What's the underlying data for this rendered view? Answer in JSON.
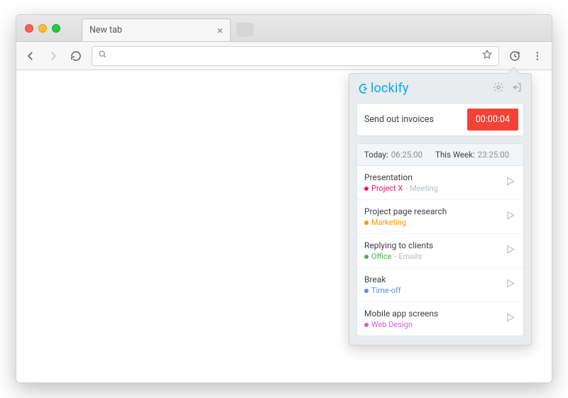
{
  "tab": {
    "title": "New tab"
  },
  "address": {
    "placeholder": ""
  },
  "popup": {
    "brand": "lockify",
    "current": {
      "label": "Send out invoices",
      "timer": "00:00:04"
    },
    "summary": {
      "today_label": "Today:",
      "today_value": "06:25:00",
      "week_label": "This Week:",
      "week_value": "23:25:00"
    },
    "entries": [
      {
        "title": "Presentation",
        "project": "Project X",
        "task": "Meeting",
        "color": "#e91e63"
      },
      {
        "title": "Project page research",
        "project": "Marketing",
        "task": "",
        "color": "#ff9800"
      },
      {
        "title": "Replying to clients",
        "project": "Office",
        "task": "Emails",
        "color": "#4caf50"
      },
      {
        "title": "Break",
        "project": "Time-off",
        "task": "",
        "color": "#5c8de8"
      },
      {
        "title": "Mobile app screens",
        "project": "Web Design",
        "task": "",
        "color": "#d85cd8"
      }
    ]
  }
}
